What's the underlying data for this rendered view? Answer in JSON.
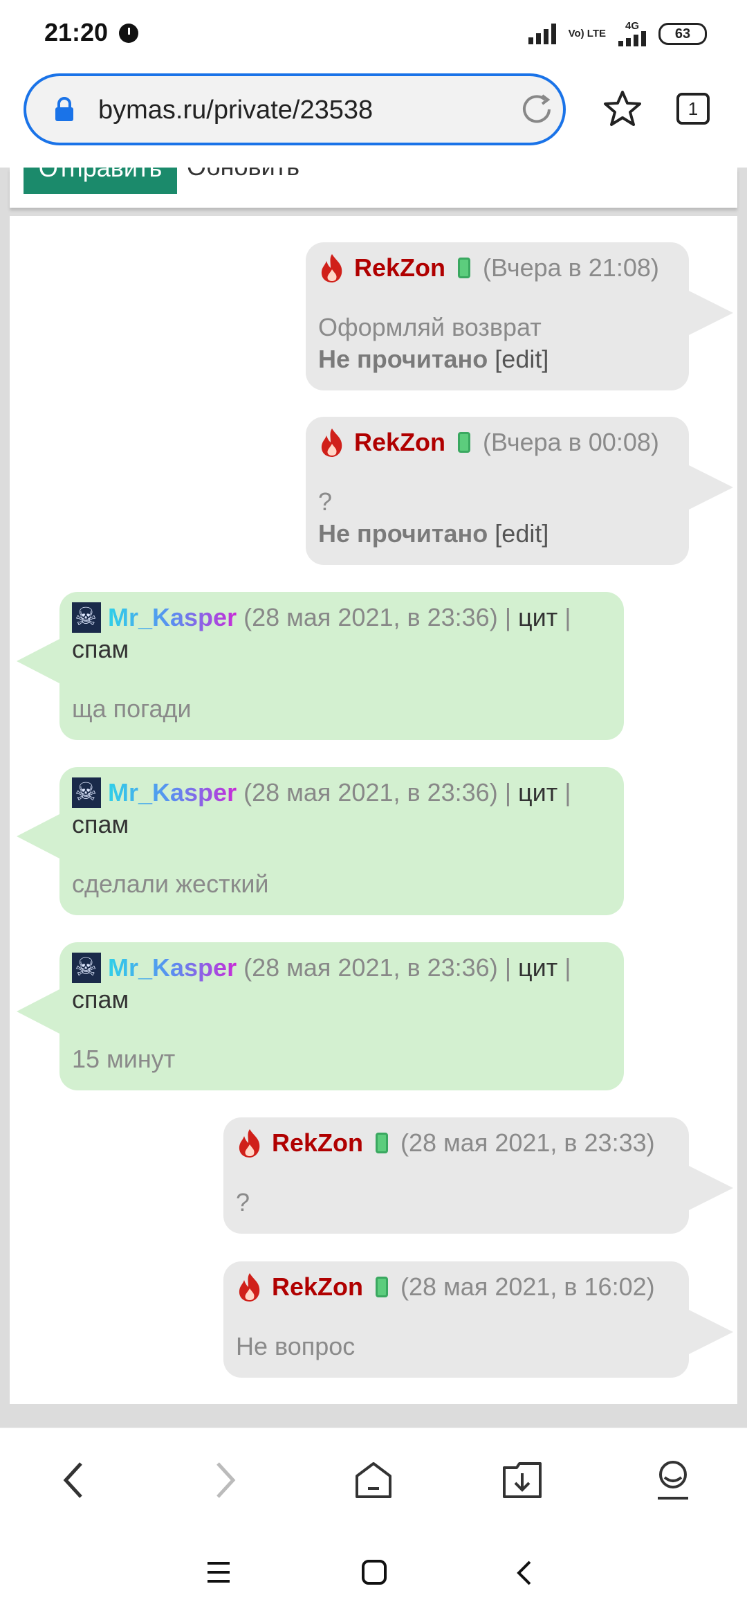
{
  "status_bar": {
    "time": "21:20",
    "network": "Vo) LTE",
    "network_type": "4G",
    "battery": "63"
  },
  "browser": {
    "url": "bymas.ru/private/23538",
    "tab_count": "1"
  },
  "page_top": {
    "send_label": "Отправить",
    "update_label": "Обновить"
  },
  "messages": [
    {
      "author": "RekZon",
      "time": "(Вчера в 21:08)",
      "text": "Оформляй возврат",
      "status": "Не прочитано",
      "edit": "[edit]"
    },
    {
      "author": "RekZon",
      "time": "(Вчера в 00:08)",
      "text": "?",
      "status": "Не прочитано",
      "edit": "[edit]"
    },
    {
      "author": "Mr_Kasper",
      "time": "(28 мая 2021, в 23:36) |",
      "quote": "цит",
      "sep": "|",
      "spam": "спам",
      "text": "ща погади"
    },
    {
      "author": "Mr_Kasper",
      "time": "(28 мая 2021, в 23:36) |",
      "quote": "цит",
      "sep": "|",
      "spam": "спам",
      "text": "сделали жесткий"
    },
    {
      "author": "Mr_Kasper",
      "time": "(28 мая 2021, в 23:36) |",
      "quote": "цит",
      "sep": "|",
      "spam": "спам",
      "text": "15 минут"
    },
    {
      "author": "RekZon",
      "time": "(28 мая 2021, в 23:33)",
      "text": "?"
    },
    {
      "author": "RekZon",
      "time": "(28 мая 2021, в 16:02)",
      "text": "Не вопрос"
    }
  ],
  "colors": {
    "accent": "#1a73e8",
    "own_message_bg": "#e8e8e8",
    "other_message_bg": "#d3f0d0",
    "rekzon_name": "#b00000",
    "send_button": "#1b8a6b"
  }
}
